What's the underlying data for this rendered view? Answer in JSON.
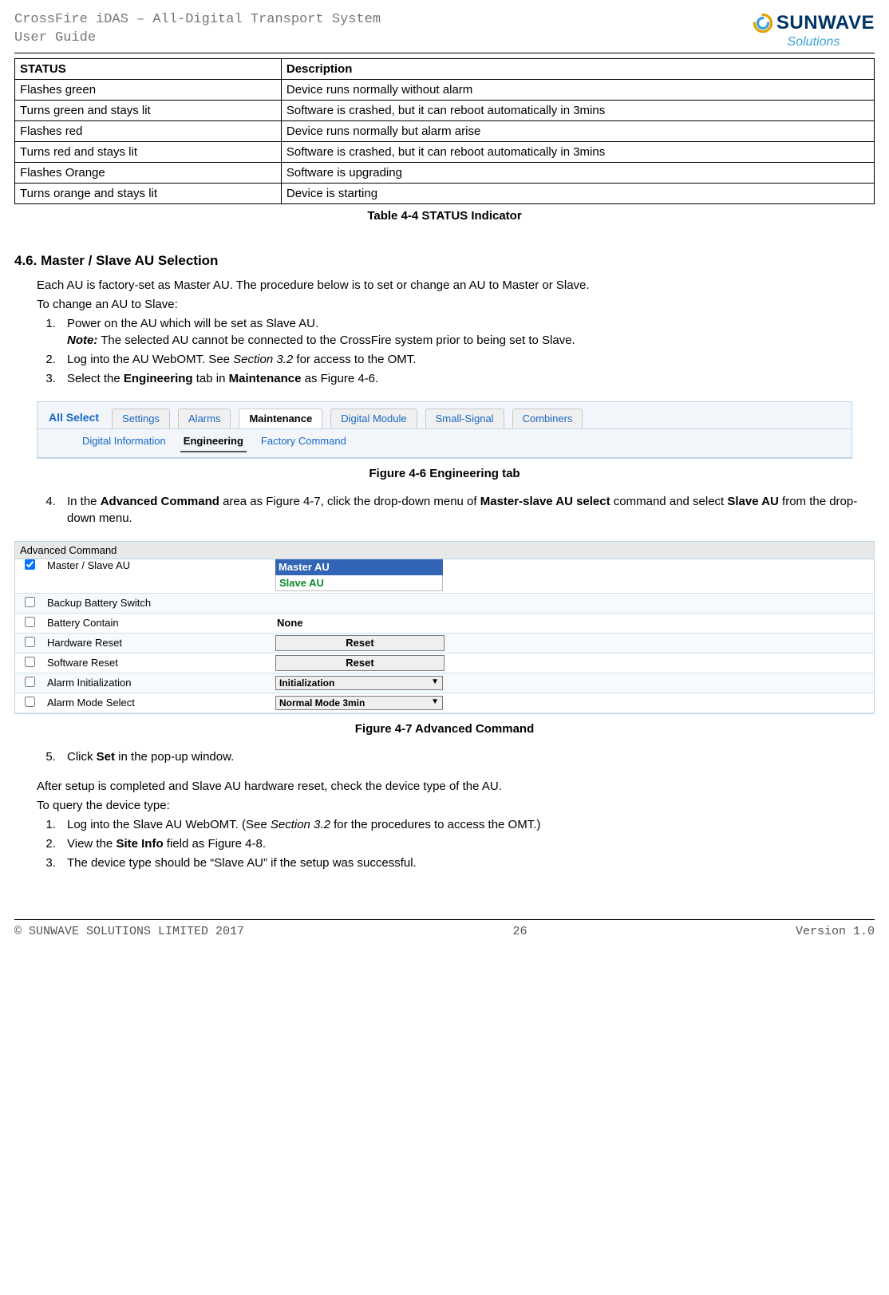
{
  "header": {
    "title_line1": "CrossFire iDAS – All-Digital Transport System",
    "title_line2": "User Guide",
    "logo_word": "SUNWAVE",
    "logo_sub": "Solutions"
  },
  "status_table": {
    "headers": [
      "STATUS",
      "Description"
    ],
    "rows": [
      [
        "Flashes green",
        "Device runs normally without alarm"
      ],
      [
        "Turns green and stays lit",
        "Software is crashed, but it can reboot automatically in 3mins"
      ],
      [
        "Flashes red",
        "Device runs normally but alarm arise"
      ],
      [
        "Turns red and stays lit",
        "Software is crashed, but it can reboot automatically in 3mins"
      ],
      [
        "Flashes Orange",
        "Software is upgrading"
      ],
      [
        "Turns orange and stays lit",
        "Device is starting"
      ]
    ],
    "caption": "Table 4-4 STATUS Indicator"
  },
  "section": {
    "number": "4.6.",
    "title": "Master / Slave AU Selection",
    "intro": "Each AU is factory-set as Master AU. The procedure below is to set or change an AU to Master or Slave.",
    "to_change": "To change an AU to Slave:",
    "steps_a": {
      "s1": "Power on the AU which will be set as Slave AU.",
      "note_label": "Note:",
      "note_text": " The selected AU cannot be connected to the CrossFire system prior to being set to Slave.",
      "s2_pre": "Log into the AU WebOMT. See ",
      "s2_em": "Section 3.2",
      "s2_post": " for access to the OMT.",
      "s3_pre": "Select the ",
      "s3_b1": "Engineering",
      "s3_mid": " tab in ",
      "s3_b2": "Maintenance",
      "s3_post": " as Figure 4-6."
    },
    "fig6": {
      "all_select": "All Select",
      "tabs": [
        "Settings",
        "Alarms",
        "Maintenance",
        "Digital Module",
        "Small-Signal",
        "Combiners"
      ],
      "subtabs": [
        "Digital Information",
        "Engineering",
        "Factory Command"
      ],
      "caption": "Figure 4-6 Engineering tab"
    },
    "step4": {
      "pre": "In the ",
      "b1": "Advanced Command",
      "mid1": " area as Figure 4-7, click the drop-down menu of ",
      "b2": "Master-slave AU select",
      "mid2": " command and select ",
      "b3": "Slave AU",
      "post": " from the drop-down menu."
    },
    "fig7": {
      "title": "Advanced Command",
      "rows": [
        {
          "checked": true,
          "label": "Master / Slave AU",
          "type": "dropdown_open",
          "selected": "Master AU",
          "option": "Slave AU"
        },
        {
          "checked": false,
          "label": "Backup Battery Switch",
          "type": "blank"
        },
        {
          "checked": false,
          "label": "Battery Contain",
          "type": "none",
          "value": "None"
        },
        {
          "checked": false,
          "label": "Hardware Reset",
          "type": "button",
          "value": "Reset"
        },
        {
          "checked": false,
          "label": "Software Reset",
          "type": "button",
          "value": "Reset"
        },
        {
          "checked": false,
          "label": "Alarm Initialization",
          "type": "select",
          "value": "Initialization"
        },
        {
          "checked": false,
          "label": "Alarm Mode Select",
          "type": "select",
          "value": "Normal Mode 3min"
        }
      ],
      "caption": "Figure 4-7 Advanced Command"
    },
    "step5_pre": "Click ",
    "step5_b": "Set",
    "step5_post": " in the pop-up window.",
    "after": "After setup is completed and Slave AU hardware reset, check the device type of the AU.",
    "to_query": "To query the device type:",
    "steps_b": {
      "s1_pre": "Log into the Slave AU WebOMT. (See ",
      "s1_em": "Section 3.2",
      "s1_post": " for the procedures to access the OMT.)",
      "s2_pre": "View the ",
      "s2_b": "Site Info",
      "s2_post": " field as Figure 4-8.",
      "s3": "The device type should be “Slave AU” if the setup was successful."
    }
  },
  "footer": {
    "left": "© SUNWAVE SOLUTIONS LIMITED 2017",
    "center": "26",
    "right": "Version 1.0"
  }
}
